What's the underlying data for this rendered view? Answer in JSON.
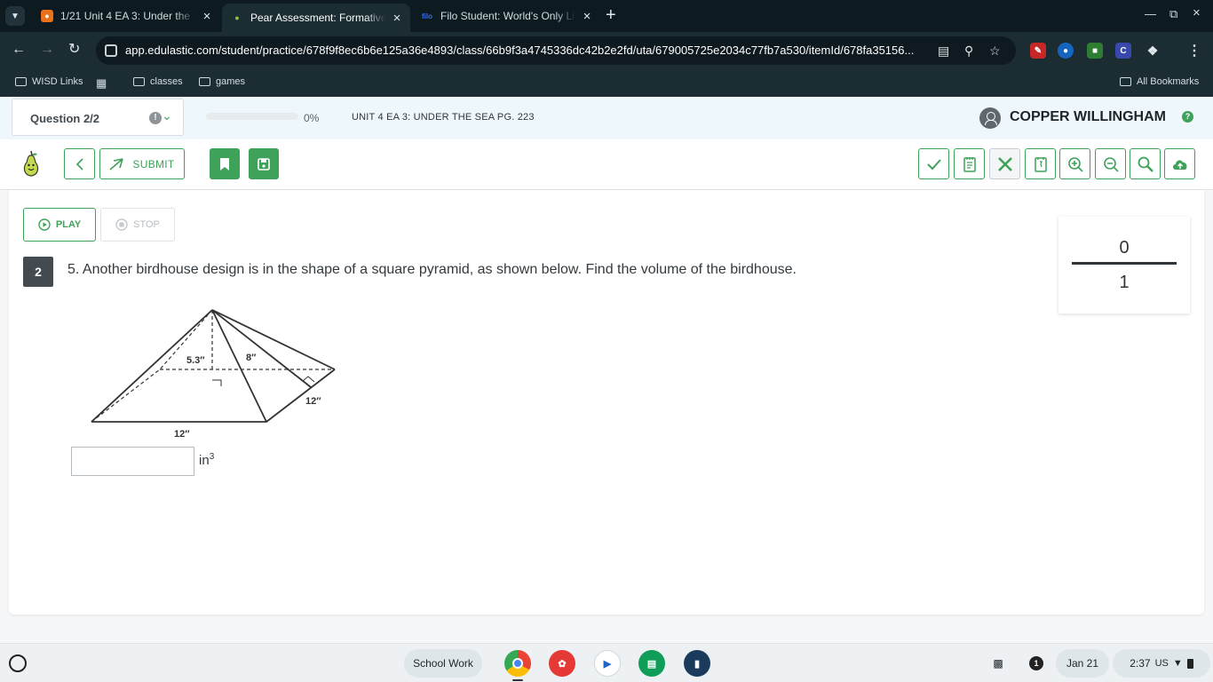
{
  "browser": {
    "tabs": [
      {
        "title": "1/21 Unit 4 EA 3: Under the Sea",
        "favicon_color": "#e8711a",
        "active": false
      },
      {
        "title": "Pear Assessment: Formative as",
        "favicon_color": "#8cc63f",
        "active": true
      },
      {
        "title": "Filo Student: World's Only Live",
        "favicon_color": "#3a6df0",
        "active": false
      }
    ],
    "url": "app.edulastic.com/student/practice/678f9f8ec6b6e125a36e4893/class/66b9f3a4745336dc42b2e2fd/uta/679005725e2034c77fb7a530/itemId/678fa35156...",
    "bookmarks": [
      {
        "label": "WISD Links",
        "icon": "bookmark-folder-icon"
      },
      {
        "label": "",
        "icon": "apps-grid-icon"
      },
      {
        "label": "classes",
        "icon": "folder-icon"
      },
      {
        "label": "games",
        "icon": "folder-icon"
      }
    ],
    "all_bookmarks": "All Bookmarks"
  },
  "app": {
    "question_selector": "Question 2/2",
    "progress_percent": 0,
    "progress_label": "0%",
    "assignment_title": "UNIT 4 EA 3: UNDER THE SEA PG. 223",
    "user_name": "COPPER WILLINGHAM",
    "accent_color": "#3fa25a",
    "toolbar": {
      "submit_label": "SUBMIT",
      "tools": [
        "check-icon",
        "notepad-icon",
        "close-x-icon",
        "calculator-icon",
        "zoom-in-icon",
        "zoom-out-icon",
        "magnifier-icon",
        "cloud-upload-icon"
      ]
    }
  },
  "question": {
    "play_label": "PLAY",
    "stop_label": "STOP",
    "number": "2",
    "text": "5.  Another birdhouse design is in the shape of a square pyramid, as shown below.  Find the volume of the birdhouse.",
    "figure_labels": {
      "height": "5.3″",
      "slant": "8″",
      "base_side": "12″",
      "base_bottom": "12″"
    },
    "answer_value": "",
    "unit": "in",
    "unit_exponent": "3"
  },
  "score": {
    "earned": "0",
    "max": "1"
  },
  "shelf": {
    "desk_label": "School Work",
    "date": "Jan 21",
    "time": "2:37",
    "locale": "US",
    "notification_count": "1"
  }
}
